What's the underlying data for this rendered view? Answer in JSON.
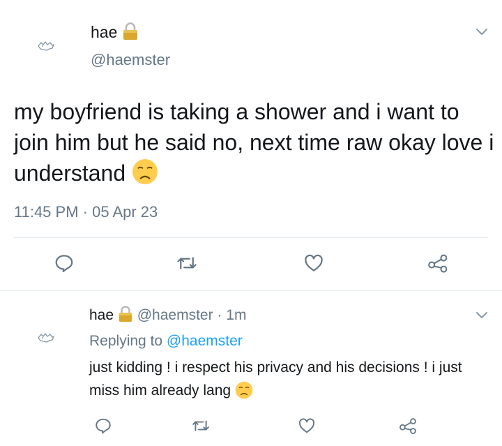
{
  "main_tweet": {
    "display_name": "hae",
    "handle": "@haemster",
    "text": "my boyfriend is taking a shower and i want to join him but he said no, next time raw okay love i understand",
    "timestamp": "11:45 PM · 05 Apr 23"
  },
  "reply": {
    "display_name": "hae",
    "handle": "@haemster",
    "time": "· 1m",
    "replying_prefix": "Replying to",
    "replying_handle": "@haemster",
    "text": "just kidding ! i respect his privacy and his decisions ! i just miss him already lang"
  },
  "icons": [
    "avatar-icon",
    "lock-icon",
    "chevron-down-icon",
    "disappointed-face-emoji-icon",
    "reply-icon",
    "retweet-icon",
    "like-icon",
    "share-icon"
  ],
  "colors": {
    "text": "#14171a",
    "muted": "#657786",
    "link": "#1da1f2",
    "divider": "#e1e8ed",
    "icon": "#657786"
  }
}
